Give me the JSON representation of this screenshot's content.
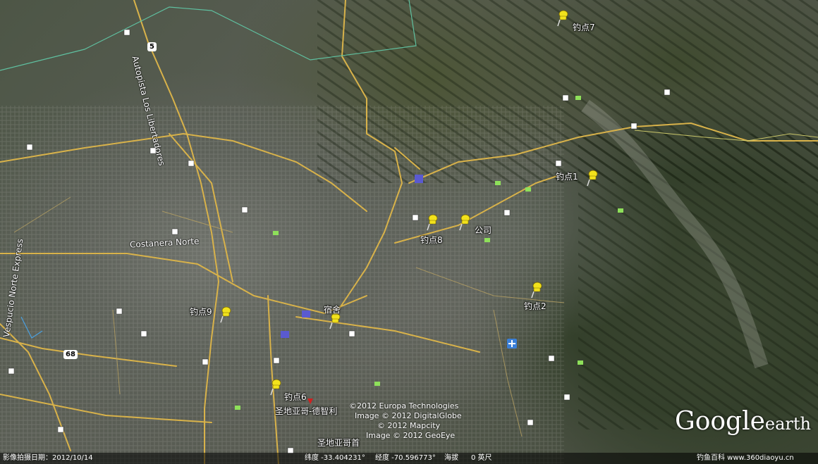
{
  "road_labels": {
    "autopista": "Autopista Los Libertadores",
    "costanera": "Costanera Norte",
    "vespucio": "Vespucio Norte Express"
  },
  "route_shields": [
    "5",
    "68"
  ],
  "pins": [
    {
      "label": "钓点7"
    },
    {
      "label": "钓点1"
    },
    {
      "label": "钓点8"
    },
    {
      "label": "公司"
    },
    {
      "label": "钓点2"
    },
    {
      "label": "钓点9"
    },
    {
      "label": "宿舍"
    },
    {
      "label": "钓点6"
    }
  ],
  "place_labels": {
    "city": "圣地亚哥-德智利",
    "city_partial": "圣地亚哥首"
  },
  "credits": [
    "©2012 Europa Technologies",
    "Image © 2012 DigitalGlobe",
    "© 2012 Mapcity",
    "Image © 2012 GeoEye"
  ],
  "brand": {
    "google": "Google",
    "earth": "earth"
  },
  "status": {
    "imagery_date": "影像拍摄日期：2012/10/14",
    "lat": "纬度  -33.404231°",
    "lon": "经度  -70.596773°",
    "elev": "海拔",
    "zero": "0 英尺",
    "watermark": "钓鱼百科 www.360diaoyu.cn"
  },
  "colors": {
    "pin": "#f2e21c",
    "road": "#d8b24a",
    "boundary": "#5fc0a0"
  }
}
